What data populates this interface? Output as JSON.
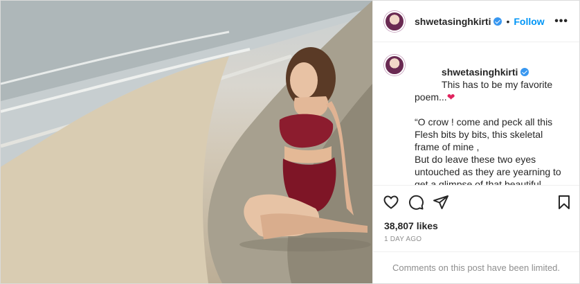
{
  "post": {
    "username": "shwetasinghkirti",
    "follow_label": "Follow",
    "separator": "•",
    "more_label": "•••",
    "caption_line1": "This has to be my favorite poem...",
    "heart_glyph": "❤",
    "caption_body": "“O crow ! come and peck all this\nFlesh bits by bits, this skeletal frame of mine ,\nBut do leave these two eyes untouched as they are yearning to get a glimpse of that beautiful beloved of mine ” - Sheikh Farid",
    "caption_time": "1d",
    "likes": "38,807 likes",
    "posted_ago": "1 DAY AGO",
    "comments_limited": "Comments on this post have been limited."
  },
  "icons": {
    "verified": "verified-badge-icon",
    "like": "heart-icon",
    "comment": "comment-icon",
    "share": "share-icon",
    "save": "bookmark-icon"
  },
  "colors": {
    "follow": "#0095f6",
    "verified": "#3897f0",
    "heart": "#e0245e",
    "muted": "#8e8e8e",
    "outfit": "#8c1c2e"
  }
}
